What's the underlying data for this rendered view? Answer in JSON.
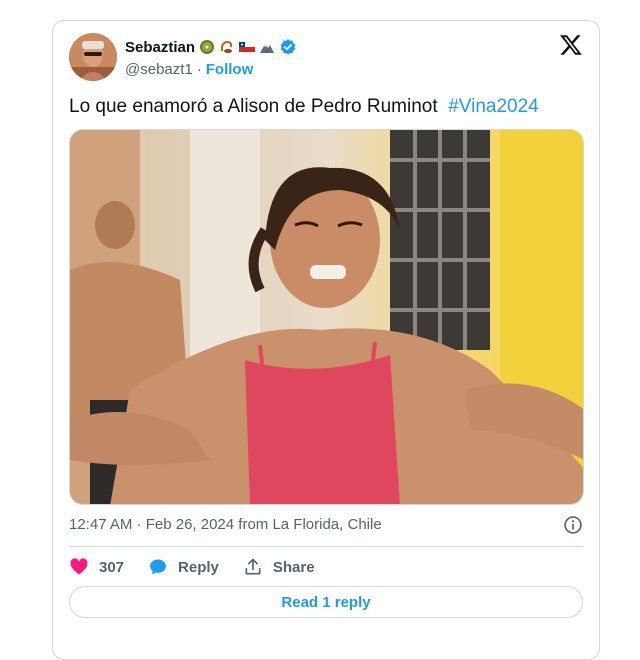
{
  "author": {
    "display_name": "Sebaztian",
    "handle": "@sebazt1",
    "separator": "·",
    "follow_label": "Follow",
    "emoji_icons": [
      "kiwi-icon",
      "scorpion-icon",
      "chile-flag-icon",
      "mountain-icon"
    ],
    "verified_color": "#1d9bf0"
  },
  "tweet": {
    "text": "Lo que enamoró a Alison de Pedro Ruminot",
    "hashtag": "#Vina2024",
    "timestamp": "12:47 AM · Feb 26, 2024 from La Florida, Chile"
  },
  "actions": {
    "likes": "307",
    "reply_label": "Reply",
    "share_label": "Share"
  },
  "read_replies_label": "Read 1 reply",
  "colors": {
    "accent": "#1d9bf0",
    "like": "#f91880",
    "text_primary": "#0f1419",
    "text_secondary": "#536471",
    "border": "#cfd9de"
  }
}
